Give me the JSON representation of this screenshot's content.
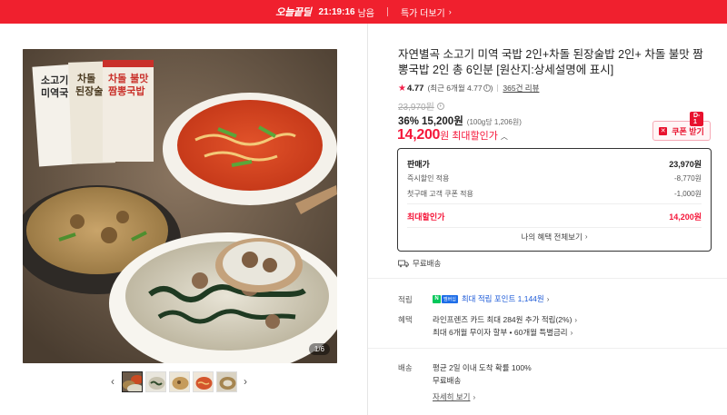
{
  "topbar": {
    "brand_main": "오늘끝딜",
    "timer": "21:19:16",
    "timer_suffix": "남음",
    "more_label": "특가 더보기",
    "color": "#f0202e"
  },
  "gallery": {
    "counter": "1/6",
    "image_text": {
      "pack1": "소고기 미역국밥",
      "pack2": "차돌 된장술밥",
      "pack3": "차돌 불맛 짬뽕국밥"
    }
  },
  "product": {
    "title": "자연별곡 소고기 미역 국밥 2인+차돌 된장술밥 2인+ 차돌 불맛 짬뽕국밥 2인 총 6인분 [원산지:상세설명에 표시]",
    "rating": "4.77",
    "rating_detail": "(최근 6개월 4.77",
    "rating_detail_close": ")",
    "reviews": "365건 리뷰",
    "original_price": "23,970원",
    "discount_pct": "36%",
    "sale_price": "15,200원",
    "unit_price": "(100g당 1,206원)",
    "best_price": "14,200",
    "best_won": "원",
    "best_label": "최대할인가",
    "accent_color": "#f5173a"
  },
  "coupon": {
    "tag": "D-1",
    "label": "쿠폰 받기",
    "icon": "coupon-icon"
  },
  "price_box": {
    "head_label": "판매가",
    "head_value": "23,970원",
    "rows": [
      {
        "label": "즉시할인 적용",
        "value": "-8,770원"
      },
      {
        "label": "첫구매 고객 쿠폰 적용",
        "value": "-1,000원"
      }
    ],
    "total_label": "최대할인가",
    "total_value": "14,200원",
    "link": "나의 혜택 전체보기"
  },
  "shipping_badge": "무료배송",
  "benefits": {
    "points_label": "적립",
    "points_text": "최대 적립 포인트 1,144원",
    "npay_n": "N",
    "npay_pay": "멤버십",
    "benefit_label": "혜택",
    "benefit_line1": "라인프렌즈 카드 최대 284원 추가 적립(2%)",
    "benefit_line2": "최대 6개월 무이자 할부 • 60개월 특별금리",
    "delivery_label": "배송",
    "delivery_line1": "평균 2일 이내 도착 확률 100%",
    "delivery_line2": "무료배송",
    "delivery_link": "자세히 보기"
  }
}
